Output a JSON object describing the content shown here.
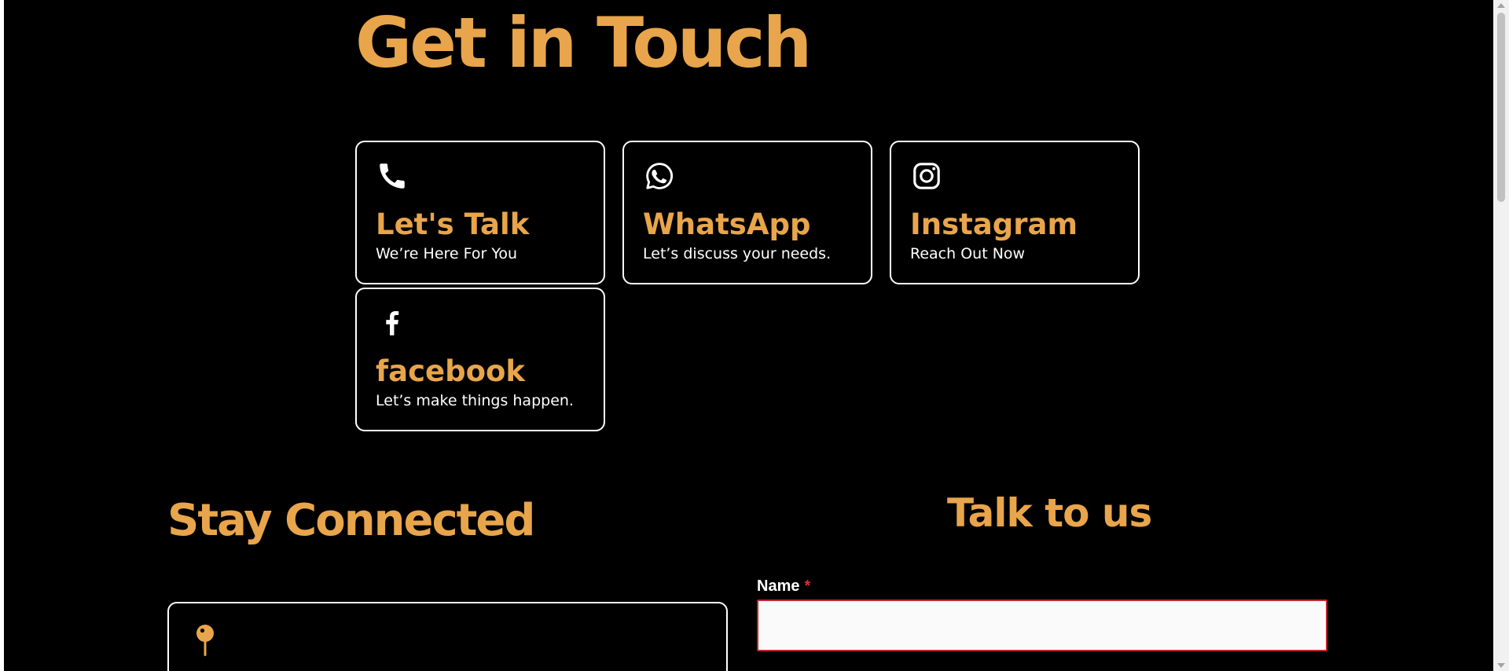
{
  "page": {
    "title": "Get in Touch"
  },
  "contact_cards": [
    {
      "icon": "phone-icon",
      "title": "Let's Talk",
      "subtitle": "We’re Here For You"
    },
    {
      "icon": "whatsapp-icon",
      "title": "WhatsApp",
      "subtitle": "Let’s discuss your needs."
    },
    {
      "icon": "instagram-icon",
      "title": "Instagram",
      "subtitle": "Reach Out Now"
    },
    {
      "icon": "facebook-icon",
      "title": "facebook",
      "subtitle": "Let’s make things happen."
    }
  ],
  "stay_connected": {
    "heading": "Stay Connected",
    "location_icon": "map-pin-icon"
  },
  "talk_form": {
    "heading": "Talk to us",
    "name_label": "Name",
    "required_marker": "*",
    "name_value": ""
  },
  "colors": {
    "background": "#000000",
    "accent": "#e8a54b",
    "text": "#ffffff",
    "required": "#e02b2b",
    "input_border": "#c0272d",
    "input_background": "#fafafa"
  }
}
